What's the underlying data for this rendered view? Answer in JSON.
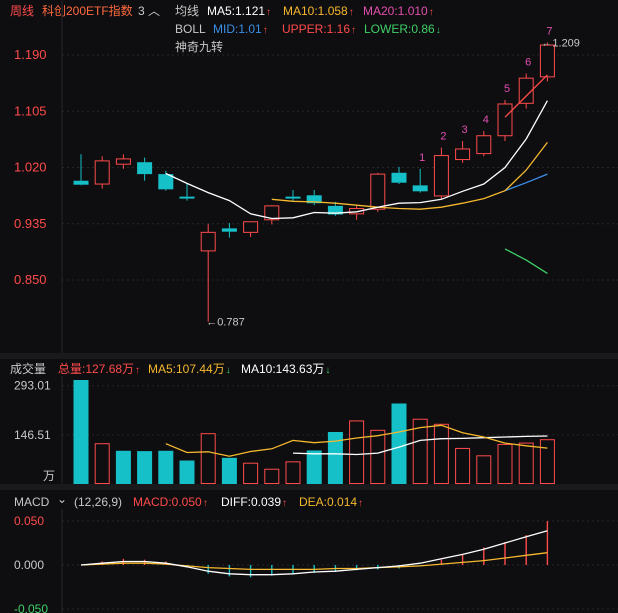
{
  "header": {
    "period": "周线",
    "title": "科创200ETF指数",
    "rank": "3",
    "collapse_glyph": "︿",
    "ma_label": "均线",
    "ma5": "MA5:1.121",
    "ma10": "MA10:1.058",
    "ma20": "MA20:1.010",
    "boll_label": "BOLL",
    "mid": "MID:1.01",
    "upper": "UPPER:1.16",
    "lower": "LOWER:0.86",
    "signal_name": "神奇九转",
    "arrow_up": "↑",
    "arrow_down": "↓"
  },
  "colors": {
    "up": "#ff4b4b",
    "down": "#16c0c8",
    "ma5": "#ffffff",
    "ma10": "#f5b82e",
    "ma20": "#e24fb0",
    "mid": "#3b8fe8",
    "upper": "#ff4b4b",
    "lower": "#3fcf67",
    "nine": "#e24fb0"
  },
  "price_axis": {
    "ticks": [
      "1.190",
      "1.105",
      "1.020",
      "0.935",
      "0.850"
    ],
    "tick_values": [
      1.19,
      1.105,
      1.02,
      0.935,
      0.85
    ]
  },
  "chart_data": [
    {
      "type": "candlestick",
      "title": "科创200ETF指数",
      "ylim": [
        0.75,
        1.225
      ],
      "candles": [
        {
          "o": 1.0,
          "h": 1.04,
          "l": 0.993,
          "c": 0.994
        },
        {
          "o": 0.995,
          "h": 1.037,
          "l": 0.988,
          "c": 1.03
        },
        {
          "o": 1.025,
          "h": 1.04,
          "l": 1.018,
          "c": 1.033
        },
        {
          "o": 1.028,
          "h": 1.035,
          "l": 1.0,
          "c": 1.01
        },
        {
          "o": 1.01,
          "h": 1.015,
          "l": 0.985,
          "c": 0.987
        },
        {
          "o": 0.976,
          "h": 0.995,
          "l": 0.97,
          "c": 0.973
        },
        {
          "o": 0.894,
          "h": 0.935,
          "l": 0.787,
          "c": 0.922
        },
        {
          "o": 0.928,
          "h": 0.936,
          "l": 0.914,
          "c": 0.923
        },
        {
          "o": 0.922,
          "h": 0.937,
          "l": 0.915,
          "c": 0.938
        },
        {
          "o": 0.941,
          "h": 0.963,
          "l": 0.934,
          "c": 0.962
        },
        {
          "o": 0.976,
          "h": 0.986,
          "l": 0.968,
          "c": 0.973
        },
        {
          "o": 0.978,
          "h": 0.986,
          "l": 0.963,
          "c": 0.966
        },
        {
          "o": 0.962,
          "h": 0.968,
          "l": 0.947,
          "c": 0.949
        },
        {
          "o": 0.95,
          "h": 0.963,
          "l": 0.941,
          "c": 0.958
        },
        {
          "o": 0.957,
          "h": 1.012,
          "l": 0.953,
          "c": 1.01
        },
        {
          "o": 1.012,
          "h": 1.021,
          "l": 0.995,
          "c": 0.997
        },
        {
          "o": 0.993,
          "h": 1.018,
          "l": 0.982,
          "c": 0.984
        },
        {
          "o": 0.977,
          "h": 1.05,
          "l": 0.972,
          "c": 1.038
        },
        {
          "o": 1.032,
          "h": 1.06,
          "l": 1.027,
          "c": 1.048
        },
        {
          "o": 1.041,
          "h": 1.075,
          "l": 1.037,
          "c": 1.068
        },
        {
          "o": 1.068,
          "h": 1.122,
          "l": 1.06,
          "c": 1.116
        },
        {
          "o": 1.117,
          "h": 1.162,
          "l": 1.109,
          "c": 1.155
        },
        {
          "o": 1.157,
          "h": 1.209,
          "l": 1.15,
          "c": 1.205
        }
      ],
      "ma5": [
        null,
        null,
        null,
        null,
        1.011,
        0.996,
        0.982,
        0.97,
        0.95,
        0.943,
        0.944,
        0.952,
        0.951,
        0.953,
        0.96,
        0.966,
        0.967,
        0.972,
        0.984,
        0.995,
        1.02,
        1.063,
        1.121
      ],
      "ma10": [
        null,
        null,
        null,
        null,
        null,
        null,
        null,
        null,
        null,
        0.972,
        0.969,
        0.968,
        0.966,
        0.963,
        0.96,
        0.958,
        0.957,
        0.96,
        0.966,
        0.973,
        0.985,
        1.016,
        1.058
      ],
      "boll_upper": [
        null,
        null,
        null,
        null,
        null,
        null,
        null,
        null,
        null,
        null,
        null,
        null,
        null,
        null,
        null,
        null,
        null,
        null,
        null,
        null,
        1.096,
        1.128,
        1.16
      ],
      "boll_mid": [
        null,
        null,
        null,
        null,
        null,
        null,
        null,
        null,
        null,
        null,
        null,
        null,
        null,
        null,
        null,
        null,
        null,
        null,
        null,
        null,
        0.985,
        0.997,
        1.01
      ],
      "boll_lower": [
        null,
        null,
        null,
        null,
        null,
        null,
        null,
        null,
        null,
        null,
        null,
        null,
        null,
        null,
        null,
        null,
        null,
        null,
        null,
        null,
        0.897,
        0.88,
        0.86
      ],
      "annotations": {
        "high_label": "1.209",
        "low_label": "0.787",
        "nine_turn": [
          "1",
          "2",
          "3",
          "4",
          "5",
          "6",
          "7"
        ],
        "nine_turn_start_index": 16
      }
    },
    {
      "type": "bar",
      "title": "成交量",
      "ylim": [
        0,
        310
      ],
      "values": [
        310,
        120,
        99,
        98,
        99,
        70,
        150,
        78,
        62,
        44,
        66,
        100,
        155,
        188,
        160,
        240,
        193,
        178,
        106,
        84,
        118,
        122,
        132
      ],
      "directions": [
        "down",
        "up",
        "down",
        "down",
        "down",
        "down",
        "up",
        "down",
        "up",
        "up",
        "up",
        "down",
        "down",
        "up",
        "up",
        "down",
        "up",
        "up",
        "up",
        "up",
        "up",
        "up",
        "up"
      ],
      "ma5": [
        null,
        null,
        null,
        null,
        null,
        null,
        null,
        null,
        null,
        null,
        null,
        null,
        null,
        null,
        null,
        null,
        null,
        null,
        null,
        null,
        null,
        null,
        null
      ],
      "ma5_line": [
        null,
        null,
        null,
        null,
        120,
        94,
        96,
        83,
        97,
        105,
        130,
        123,
        128,
        137,
        144,
        155,
        168,
        175,
        153,
        140,
        122,
        114,
        107
      ],
      "ma10_line": [
        null,
        null,
        null,
        null,
        null,
        null,
        null,
        null,
        null,
        null,
        92,
        90,
        90,
        88,
        92,
        110,
        130,
        135,
        136,
        138,
        140,
        142,
        143
      ]
    },
    {
      "type": "line",
      "title": "MACD",
      "ylim": [
        -0.05,
        0.05
      ],
      "macd_hist": [
        0.0,
        0.004,
        0.007,
        0.006,
        0.004,
        -0.002,
        -0.01,
        -0.013,
        -0.014,
        -0.012,
        -0.01,
        -0.009,
        -0.008,
        -0.006,
        -0.005,
        -0.004,
        -0.001,
        0.006,
        0.012,
        0.02,
        0.026,
        0.034,
        0.05
      ],
      "diff": [
        0.0,
        0.002,
        0.004,
        0.004,
        0.002,
        -0.002,
        -0.007,
        -0.01,
        -0.011,
        -0.011,
        -0.01,
        -0.008,
        -0.007,
        -0.005,
        -0.003,
        -0.001,
        0.002,
        0.007,
        0.012,
        0.018,
        0.025,
        0.032,
        0.039
      ],
      "dea": [
        0.0,
        0.001,
        0.002,
        0.002,
        0.001,
        -0.001,
        -0.003,
        -0.004,
        -0.005,
        -0.005,
        -0.005,
        -0.005,
        -0.004,
        -0.004,
        -0.003,
        -0.002,
        -0.001,
        0.001,
        0.003,
        0.005,
        0.008,
        0.011,
        0.014
      ]
    }
  ],
  "volume": {
    "title": "成交量",
    "total": "总量:127.68万",
    "ma5": "MA5:107.44万",
    "ma10": "MA10:143.63万",
    "ticks": [
      "293.01",
      "146.51"
    ],
    "unit": "万"
  },
  "macd": {
    "title": "MACD",
    "params": "(12,26,9)",
    "macd_val": "MACD:0.050",
    "diff_val": "DIFF:0.039",
    "dea_val": "DEA:0.014",
    "ticks": [
      "0.050",
      "0.000",
      "-0.050"
    ],
    "dropdown_glyph": "⌄"
  }
}
